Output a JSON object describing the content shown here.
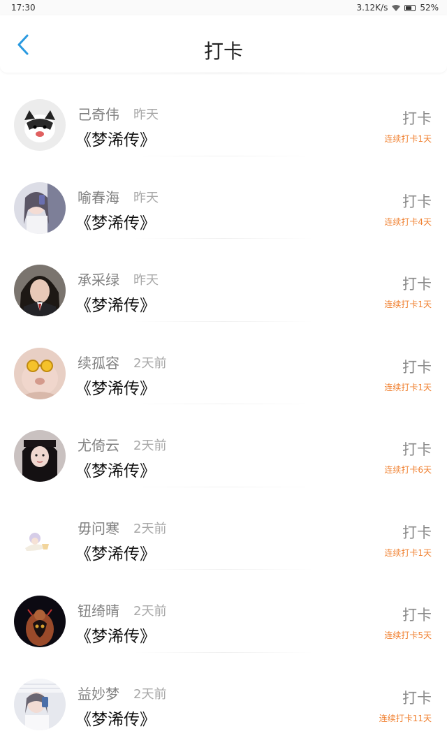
{
  "status_bar": {
    "time": "17:30",
    "network_speed": "3.12K/s",
    "battery": "52%"
  },
  "header": {
    "title": "打卡",
    "back_icon": "chevron-left-icon"
  },
  "colors": {
    "accent": "#2a9ae0",
    "streak": "#f08030"
  },
  "entries": [
    {
      "name": "己奇伟",
      "time": "昨天",
      "book": "《梦浠传》",
      "button": "打卡",
      "streak": "连续打卡1天"
    },
    {
      "name": "喻春海",
      "time": "昨天",
      "book": "《梦浠传》",
      "button": "打卡",
      "streak": "连续打卡4天"
    },
    {
      "name": "承采绿",
      "time": "昨天",
      "book": "《梦浠传》",
      "button": "打卡",
      "streak": "连续打卡1天"
    },
    {
      "name": "续孤容",
      "time": "2天前",
      "book": "《梦浠传》",
      "button": "打卡",
      "streak": "连续打卡1天"
    },
    {
      "name": "尤倚云",
      "time": "2天前",
      "book": "《梦浠传》",
      "button": "打卡",
      "streak": "连续打卡6天"
    },
    {
      "name": "毋问寒",
      "time": "2天前",
      "book": "《梦浠传》",
      "button": "打卡",
      "streak": "连续打卡1天"
    },
    {
      "name": "钮绮晴",
      "time": "2天前",
      "book": "《梦浠传》",
      "button": "打卡",
      "streak": "连续打卡5天"
    },
    {
      "name": "益妙梦",
      "time": "2天前",
      "book": "《梦浠传》",
      "button": "打卡",
      "streak": "连续打卡11天"
    }
  ]
}
